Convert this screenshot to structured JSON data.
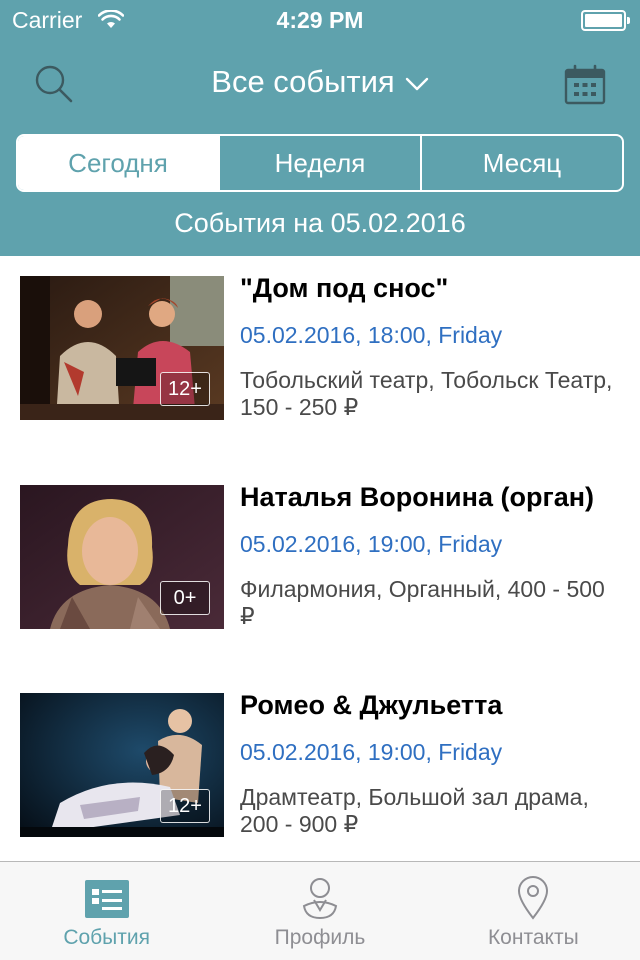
{
  "status_bar": {
    "carrier": "Carrier",
    "time": "4:29 PM"
  },
  "nav": {
    "title": "Все события",
    "search_icon": "search-icon",
    "calendar_icon": "calendar-icon"
  },
  "segments": [
    {
      "label": "Сегодня",
      "active": true
    },
    {
      "label": "Неделя",
      "active": false
    },
    {
      "label": "Месяц",
      "active": false
    }
  ],
  "date_caption": "События на 05.02.2016",
  "events": [
    {
      "title": "\"Дом под снос\"",
      "datetime": "05.02.2016, 18:00, Friday",
      "place": "Тобольский театр, Тобольск Театр, 150 - 250 ₽",
      "age": "12+"
    },
    {
      "title": "Наталья Воронина (орган)",
      "datetime": "05.02.2016, 19:00, Friday",
      "place": "Филармония, Органный, 400 - 500 ₽",
      "age": "0+"
    },
    {
      "title": "Ромео & Джульетта",
      "datetime": "05.02.2016, 19:00, Friday",
      "place": "Драмтеатр, Большой зал драма, 200 - 900 ₽",
      "age": "12+"
    }
  ],
  "tabbar": [
    {
      "label": "События",
      "icon": "list-icon",
      "active": true
    },
    {
      "label": "Профиль",
      "icon": "profile-icon",
      "active": false
    },
    {
      "label": "Контакты",
      "icon": "location-pin-icon",
      "active": false
    }
  ],
  "colors": {
    "accent": "#5fa2ad",
    "date_blue": "#2f6fc1",
    "text": "#000000",
    "secondary_text": "#4a4a4a"
  }
}
